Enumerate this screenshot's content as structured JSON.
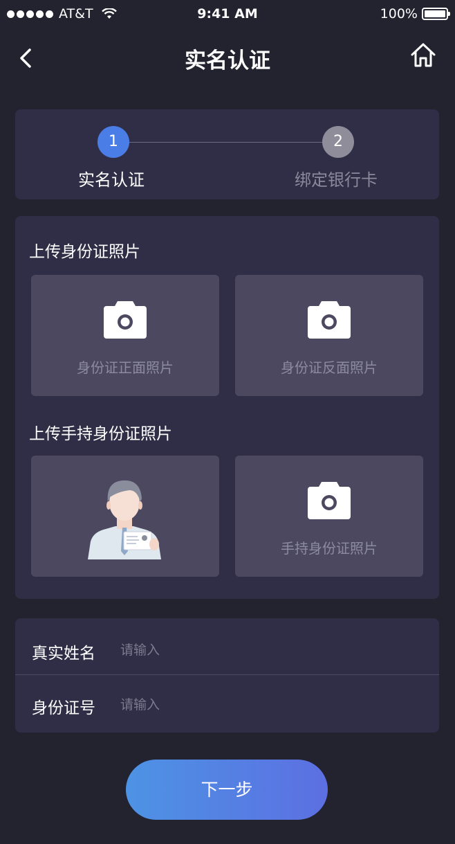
{
  "status_bar": {
    "carrier": "AT&T",
    "time": "9:41 AM",
    "battery": "100%"
  },
  "nav": {
    "title": "实名认证",
    "back_icon": "chevron-left-icon",
    "home_icon": "home-icon"
  },
  "steps": [
    {
      "number": "1",
      "label": "实名认证",
      "active": true
    },
    {
      "number": "2",
      "label": "绑定银行卡",
      "active": false
    }
  ],
  "upload": {
    "id_section_title": "上传身份证照片",
    "id_front_label": "身份证正面照片",
    "id_back_label": "身份证反面照片",
    "handheld_section_title": "上传手持身份证照片",
    "handheld_label": "手持身份证照片",
    "camera_icon": "camera-icon"
  },
  "form": {
    "name_label": "真实姓名",
    "name_placeholder": "请输入",
    "id_label": "身份证号",
    "id_placeholder": "请输入"
  },
  "next_button": "下一步",
  "colors": {
    "background": "#23222f",
    "card": "#302e46",
    "tile": "#4b4860",
    "accent": "#4a7ee6"
  }
}
